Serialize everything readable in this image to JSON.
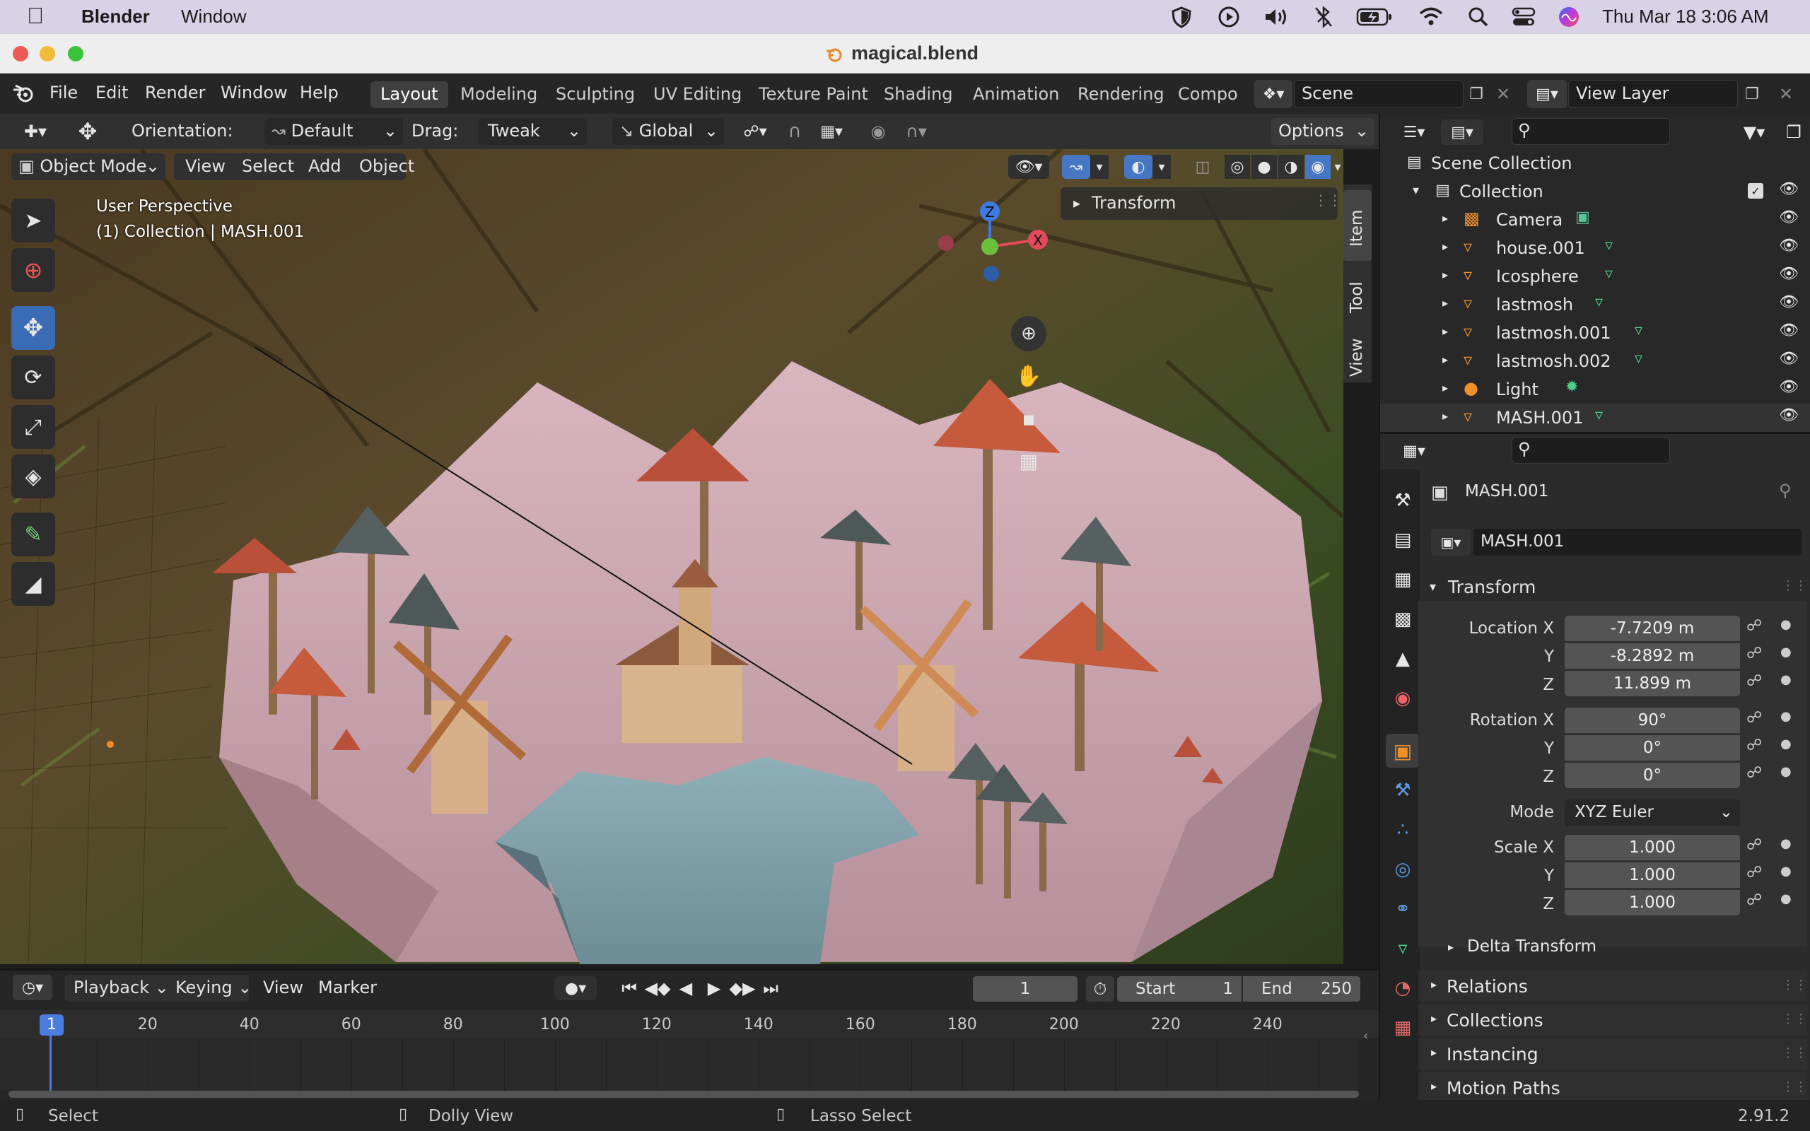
{
  "macos": {
    "app": "Blender",
    "menu": [
      "Window"
    ],
    "clock": "Thu Mar 18  3:06 AM"
  },
  "window": {
    "title": "magical.blend"
  },
  "topbar": {
    "menus": [
      "File",
      "Edit",
      "Render",
      "Window",
      "Help"
    ],
    "workspaces": [
      "Layout",
      "Modeling",
      "Sculpting",
      "UV Editing",
      "Texture Paint",
      "Shading",
      "Animation",
      "Rendering",
      "Compo"
    ],
    "active_workspace": "Layout",
    "scene": "Scene",
    "view_layer": "View Layer"
  },
  "toolheader": {
    "orientation_label": "Orientation:",
    "orientation_value": "Default",
    "drag_label": "Drag:",
    "drag_value": "Tweak",
    "transform_space": "Global",
    "options": "Options"
  },
  "viewport_header": {
    "mode": "Object Mode",
    "menus": [
      "View",
      "Select",
      "Add",
      "Object"
    ]
  },
  "viewport": {
    "overlay_line1": "User Perspective",
    "overlay_line2": "(1) Collection | MASH.001",
    "npanel_section": "Transform",
    "npanel_tabs": [
      "Item",
      "Tool",
      "View"
    ],
    "gizmo": {
      "z": "Z",
      "x": "X",
      "y": "Y"
    }
  },
  "outliner": {
    "root": "Scene Collection",
    "collection": "Collection",
    "items": [
      {
        "name": "Camera",
        "type": "camera"
      },
      {
        "name": "house.001",
        "type": "mesh"
      },
      {
        "name": "Icosphere",
        "type": "mesh"
      },
      {
        "name": "lastmosh",
        "type": "mesh"
      },
      {
        "name": "lastmosh.001",
        "type": "mesh"
      },
      {
        "name": "lastmosh.002",
        "type": "mesh"
      },
      {
        "name": "Light",
        "type": "light"
      },
      {
        "name": "MASH.001",
        "type": "mesh"
      }
    ]
  },
  "properties": {
    "object_name": "MASH.001",
    "object_field": "MASH.001",
    "transform_title": "Transform",
    "location": {
      "label": "Location X",
      "x": "-7.7209 m",
      "y": "-8.2892 m",
      "z": "11.899 m"
    },
    "rotation": {
      "label": "Rotation X",
      "x": "90°",
      "y": "0°",
      "z": "0°"
    },
    "mode_label": "Mode",
    "mode_value": "XYZ Euler",
    "scale": {
      "label": "Scale X",
      "x": "1.000",
      "y": "1.000",
      "z": "1.000"
    },
    "axis_y": "Y",
    "axis_z": "Z",
    "delta": "Delta Transform",
    "sections": [
      "Relations",
      "Collections",
      "Instancing",
      "Motion Paths"
    ]
  },
  "timeline": {
    "menus": [
      "Playback",
      "Keying",
      "View",
      "Marker"
    ],
    "current_frame": "1",
    "start_label": "Start",
    "start": "1",
    "end_label": "End",
    "end": "250",
    "ticks": [
      "1",
      "20",
      "40",
      "60",
      "80",
      "100",
      "120",
      "140",
      "160",
      "180",
      "200",
      "220",
      "240"
    ]
  },
  "status": {
    "left": "Select",
    "mid": "Dolly View",
    "right": "Lasso Select",
    "version": "2.91.2"
  }
}
